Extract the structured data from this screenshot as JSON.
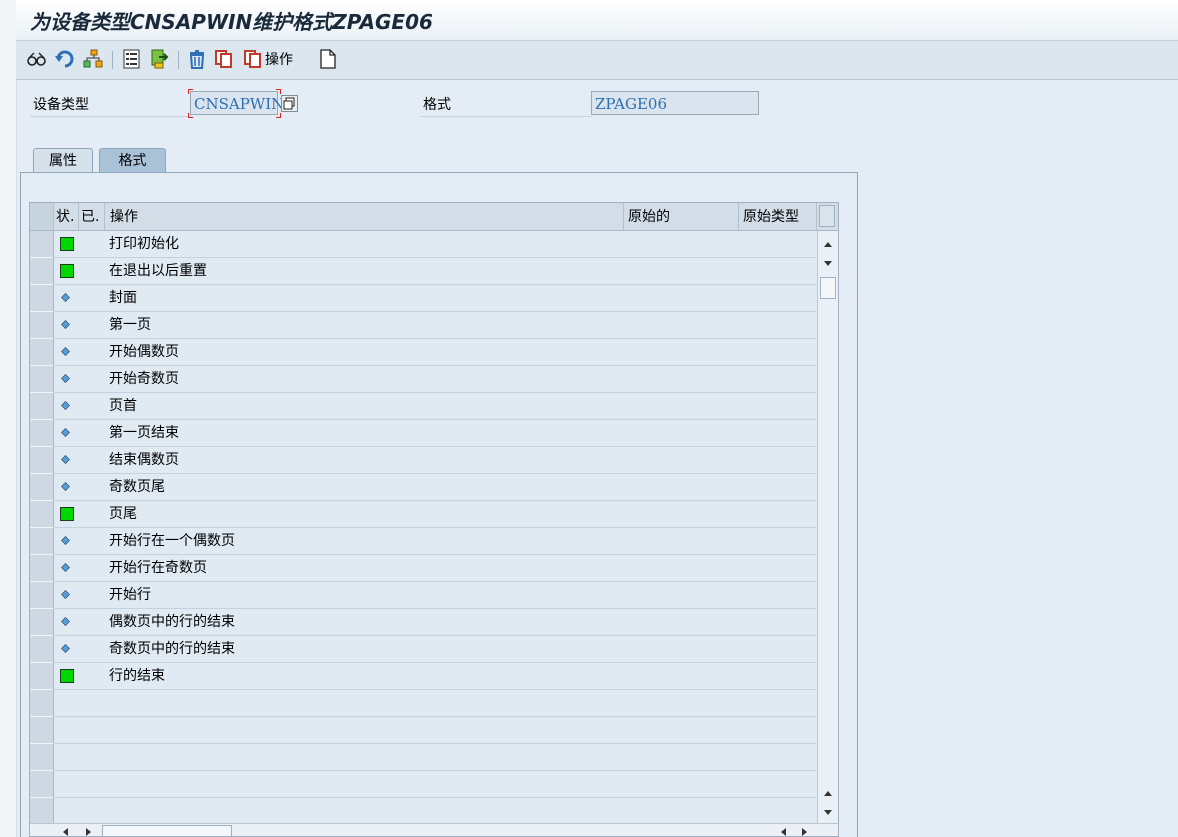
{
  "window": {
    "title": "为设备类型CNSAPWIN维护格式ZPAGE06"
  },
  "toolbar": {
    "operation_label": "操作",
    "icons": [
      "glasses-icon",
      "undo-icon",
      "hierarchy-icon",
      "list-icon",
      "export-icon",
      "delete-icon",
      "copy-icon",
      "copy-operation-icon",
      "new-document-icon"
    ]
  },
  "fields": {
    "device_type_label": "设备类型",
    "device_type_value": "CNSAPWIN",
    "format_label": "格式",
    "format_value": "ZPAGE06"
  },
  "tabs": [
    {
      "label": "属性",
      "active": false
    },
    {
      "label": "格式",
      "active": true
    }
  ],
  "table": {
    "columns": [
      "状.",
      "已.",
      "操作",
      "原始的",
      "原始类型"
    ],
    "rows": [
      {
        "status": "green-square",
        "operation": "打印初始化"
      },
      {
        "status": "green-square",
        "operation": "在退出以后重置"
      },
      {
        "status": "diamond",
        "operation": "封面"
      },
      {
        "status": "diamond",
        "operation": "第一页"
      },
      {
        "status": "diamond",
        "operation": "开始偶数页"
      },
      {
        "status": "diamond",
        "operation": "开始奇数页"
      },
      {
        "status": "diamond",
        "operation": "页首"
      },
      {
        "status": "diamond",
        "operation": "第一页结束"
      },
      {
        "status": "diamond",
        "operation": "结束偶数页"
      },
      {
        "status": "diamond",
        "operation": "奇数页尾"
      },
      {
        "status": "green-square",
        "operation": "页尾"
      },
      {
        "status": "diamond",
        "operation": "开始行在一个偶数页"
      },
      {
        "status": "diamond",
        "operation": "开始行在奇数页"
      },
      {
        "status": "diamond",
        "operation": "开始行"
      },
      {
        "status": "diamond",
        "operation": "偶数页中的行的结束"
      },
      {
        "status": "diamond",
        "operation": "奇数页中的行的结束"
      },
      {
        "status": "green-square",
        "operation": "行的结束"
      }
    ],
    "empty_rows": 5
  },
  "colors": {
    "status_green": "#00d800",
    "diamond_blue": "#5b9bd0",
    "input_text": "#2e6faf"
  }
}
